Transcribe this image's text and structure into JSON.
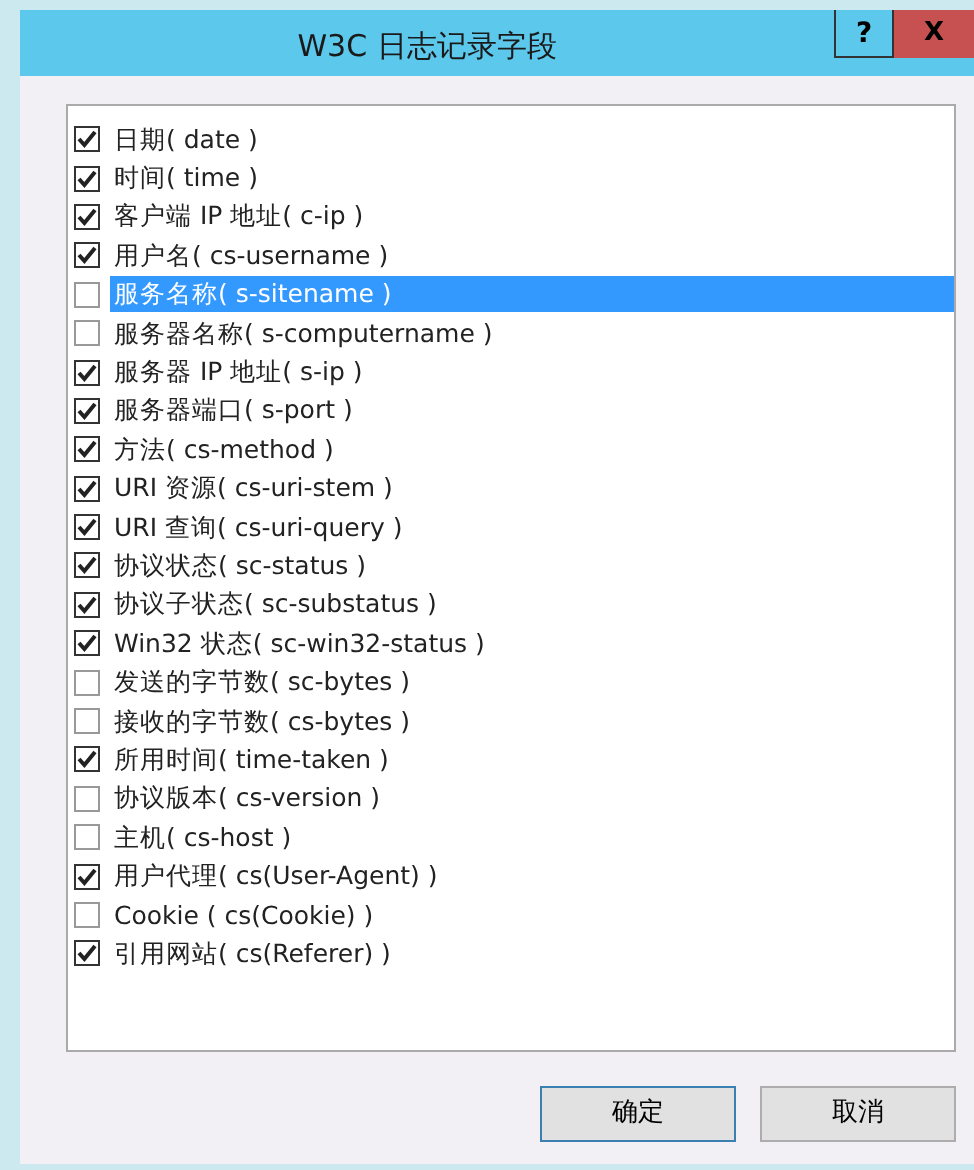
{
  "window": {
    "title": "W3C 日志记录字段",
    "help": "?",
    "close": "X"
  },
  "fields": [
    {
      "label": "日期( date )",
      "checked": true,
      "selected": false
    },
    {
      "label": "时间( time )",
      "checked": true,
      "selected": false
    },
    {
      "label": "客户端 IP 地址( c-ip )",
      "checked": true,
      "selected": false
    },
    {
      "label": "用户名( cs-username )",
      "checked": true,
      "selected": false
    },
    {
      "label": "服务名称( s-sitename )",
      "checked": false,
      "selected": true
    },
    {
      "label": "服务器名称( s-computername )",
      "checked": false,
      "selected": false
    },
    {
      "label": "服务器 IP 地址( s-ip )",
      "checked": true,
      "selected": false
    },
    {
      "label": "服务器端口( s-port )",
      "checked": true,
      "selected": false
    },
    {
      "label": "方法( cs-method )",
      "checked": true,
      "selected": false
    },
    {
      "label": "URI 资源( cs-uri-stem )",
      "checked": true,
      "selected": false
    },
    {
      "label": "URI 查询( cs-uri-query )",
      "checked": true,
      "selected": false
    },
    {
      "label": "协议状态( sc-status )",
      "checked": true,
      "selected": false
    },
    {
      "label": "协议子状态( sc-substatus )",
      "checked": true,
      "selected": false
    },
    {
      "label": "Win32 状态( sc-win32-status )",
      "checked": true,
      "selected": false
    },
    {
      "label": "发送的字节数( sc-bytes )",
      "checked": false,
      "selected": false
    },
    {
      "label": "接收的字节数( cs-bytes )",
      "checked": false,
      "selected": false
    },
    {
      "label": "所用时间( time-taken )",
      "checked": true,
      "selected": false
    },
    {
      "label": "协议版本( cs-version )",
      "checked": false,
      "selected": false
    },
    {
      "label": "主机( cs-host )",
      "checked": false,
      "selected": false
    },
    {
      "label": "用户代理( cs(User-Agent) )",
      "checked": true,
      "selected": false
    },
    {
      "label": "Cookie ( cs(Cookie) )",
      "checked": false,
      "selected": false
    },
    {
      "label": "引用网站( cs(Referer) )",
      "checked": true,
      "selected": false
    }
  ],
  "buttons": [
    {
      "label": "确定",
      "default": true
    },
    {
      "label": "取消",
      "default": false
    }
  ]
}
